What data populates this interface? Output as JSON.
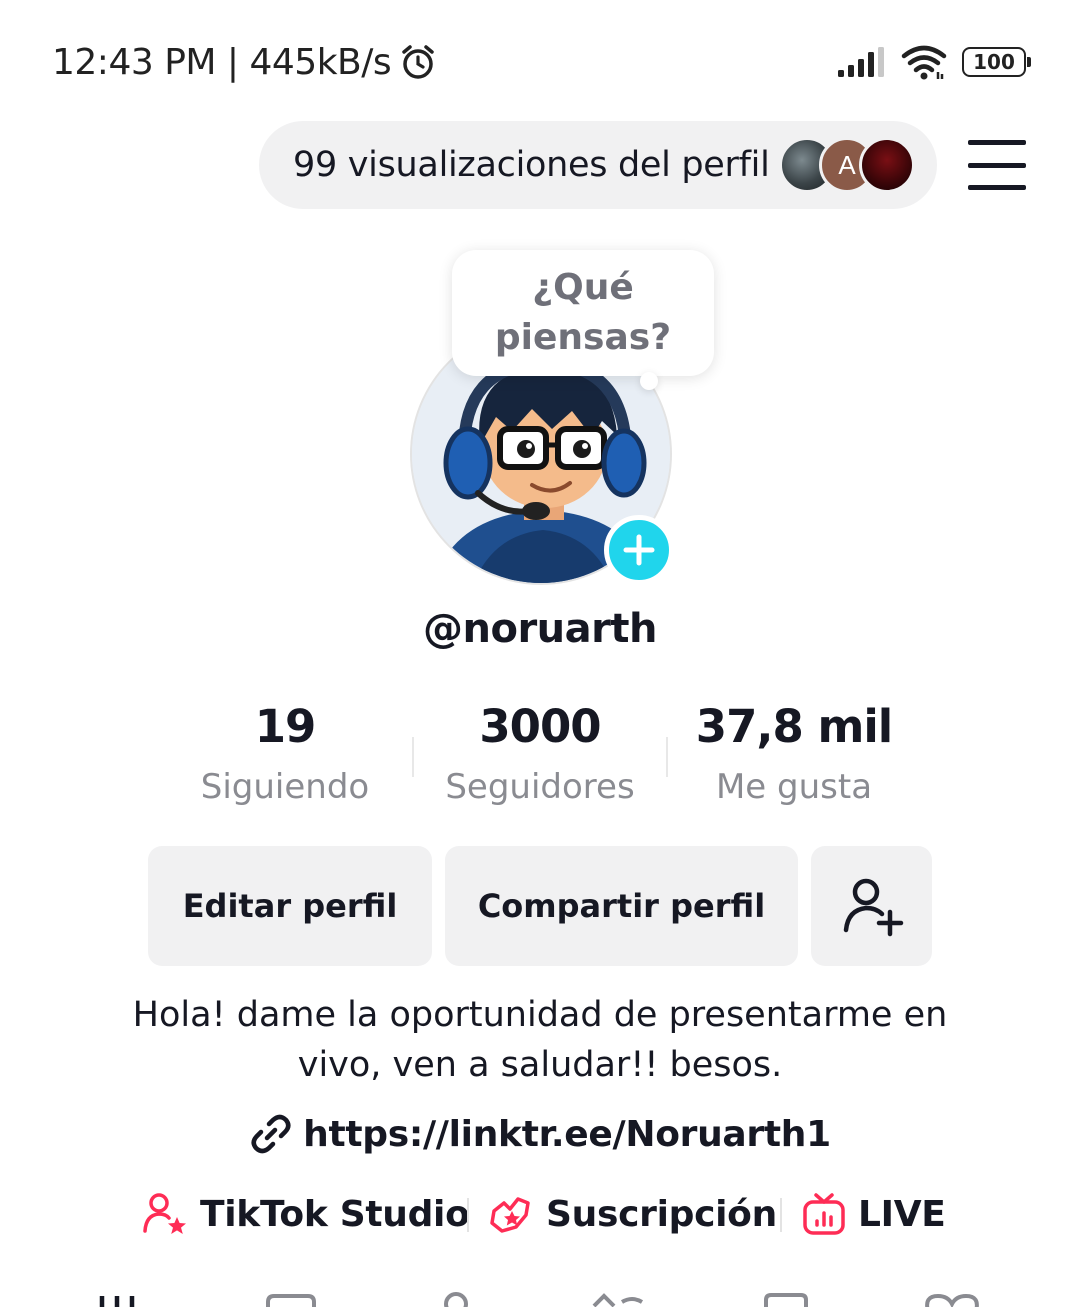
{
  "status_bar": {
    "time_speed": "12:43 PM | 445kB/s",
    "battery": "100"
  },
  "header": {
    "profile_views": "99 visualizaciones del perfil",
    "viewer_initial": "A"
  },
  "profile": {
    "bubble_line1": "¿Qué",
    "bubble_line2": "piensas?",
    "username": "@noruarth"
  },
  "stats": [
    {
      "value": "19",
      "label": "Siguiendo"
    },
    {
      "value": "3000",
      "label": "Seguidores"
    },
    {
      "value": "37,8 mil",
      "label": "Me gusta"
    }
  ],
  "actions": {
    "edit": "Editar perfil",
    "share": "Compartir perfil"
  },
  "bio": {
    "line1": "Hola! dame la oportunidad de presentarme en",
    "line2": "vivo, ven a saludar!! besos.",
    "link": "https://linktr.ee/Noruarth1"
  },
  "shortcuts": [
    {
      "label": "TikTok Studio",
      "icon": "studio-icon"
    },
    {
      "label": "Suscripción",
      "icon": "subscription-icon"
    },
    {
      "label": "LIVE",
      "icon": "live-tv-icon"
    }
  ],
  "colors": {
    "accent_pink": "#fe2c55",
    "accent_cyan": "#20d5ec",
    "pill_bg": "#f1f1f2"
  }
}
